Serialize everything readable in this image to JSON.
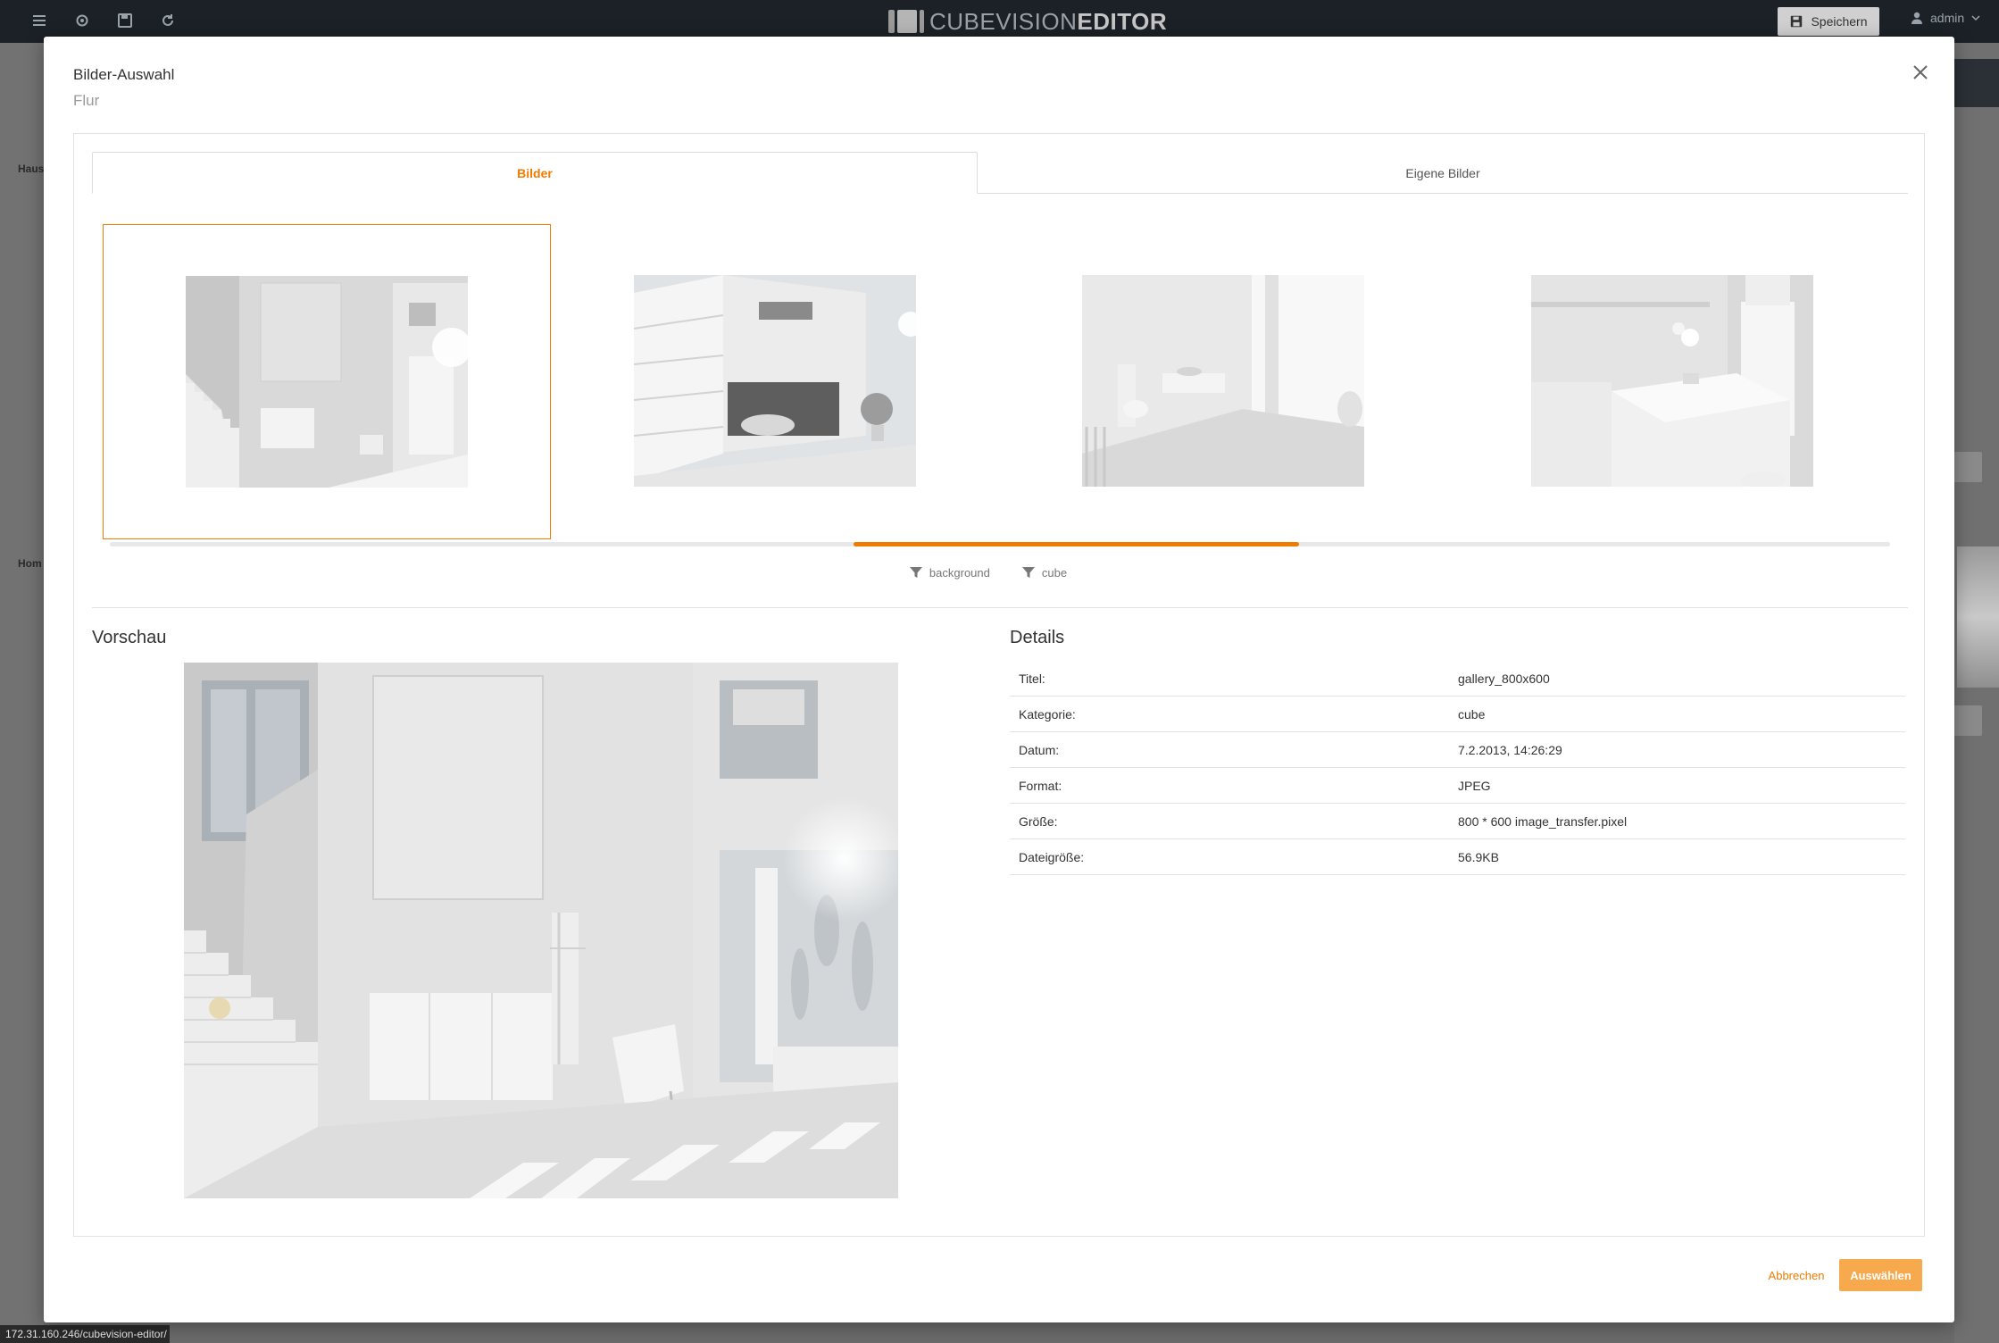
{
  "app": {
    "logo_light": "CUBEVISION",
    "logo_bold": "EDITOR",
    "save_label": "Speichern",
    "user_name": "admin",
    "status_url": "172.31.160.246/cubevision-editor/",
    "bg_sidebar_labels": [
      "Haus",
      "Hom"
    ],
    "toolbar_icons": [
      "menu-icon",
      "settings-icon",
      "save-icon",
      "refresh-icon"
    ]
  },
  "modal": {
    "title": "Bilder-Auswahl",
    "subtitle": "Flur",
    "tabs": [
      {
        "label": "Bilder",
        "active": true
      },
      {
        "label": "Eigene Bilder",
        "active": false
      }
    ],
    "thumbnails": [
      {
        "scene": "hallway-stairs",
        "selected": true
      },
      {
        "scene": "house-garage",
        "selected": false
      },
      {
        "scene": "bathroom",
        "selected": false
      },
      {
        "scene": "kitchen",
        "selected": false
      }
    ],
    "filters": [
      "background",
      "cube"
    ],
    "preview_title": "Vorschau",
    "details_title": "Details",
    "details": [
      {
        "label": "Titel:",
        "value": "gallery_800x600"
      },
      {
        "label": "Kategorie:",
        "value": "cube"
      },
      {
        "label": "Datum:",
        "value": "7.2.2013, 14:26:29"
      },
      {
        "label": "Format:",
        "value": "JPEG"
      },
      {
        "label": "Größe:",
        "value": "800 * 600 image_transfer.pixel"
      },
      {
        "label": "Dateigröße:",
        "value": "56.9KB"
      }
    ],
    "cancel_label": "Abbrechen",
    "select_label": "Auswählen"
  },
  "colors": {
    "accent": "#ef7b00",
    "accent_light": "#f7a94d",
    "topbar": "#1b2127"
  }
}
